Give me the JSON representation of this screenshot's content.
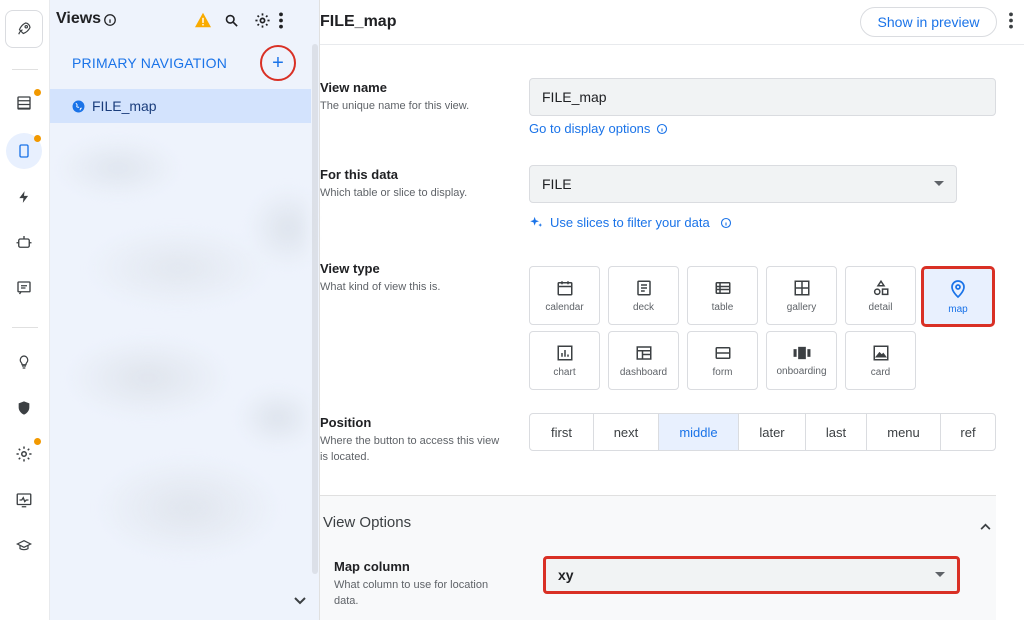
{
  "rail": {
    "icons": [
      "rocket-icon",
      "data-table-icon",
      "mobile-views-icon",
      "automation-bolt-icon",
      "bot-icon",
      "chat-icon",
      "lightbulb-icon",
      "shield-icon",
      "settings-gear-icon",
      "monitor-pulse-icon",
      "graduation-cap-icon"
    ],
    "dot_color": "#f29900"
  },
  "views_panel": {
    "title": "Views",
    "nav_section": "PRIMARY NAVIGATION",
    "add_label": "+",
    "items": [
      {
        "label": "FILE_map"
      }
    ]
  },
  "main": {
    "title": "FILE_map",
    "preview_button": "Show in preview",
    "view_name": {
      "label": "View name",
      "description": "The unique name for this view.",
      "value": "FILE_map",
      "link": "Go to display options"
    },
    "for_data": {
      "label": "For this data",
      "description": "Which table or slice to display.",
      "value": "FILE",
      "link": "Use slices to filter your data"
    },
    "view_type": {
      "label": "View type",
      "description": "What kind of view this is.",
      "options": [
        "calendar",
        "deck",
        "table",
        "gallery",
        "detail",
        "map",
        "chart",
        "dashboard",
        "form",
        "onboarding",
        "card"
      ],
      "selected": "map"
    },
    "position": {
      "label": "Position",
      "description": "Where the button to access this view is located.",
      "options": [
        "first",
        "next",
        "middle",
        "later",
        "last",
        "menu",
        "ref"
      ],
      "selected": "middle"
    },
    "view_options": {
      "title": "View Options",
      "map_column": {
        "label": "Map column",
        "description": "What column to use for location data.",
        "value": "xy"
      }
    }
  },
  "colors": {
    "accent": "#1a73e8",
    "highlight": "#d93025",
    "selected_bg": "#e8f0fe",
    "panel_bg": "#eef3fc",
    "warning": "#f9ab00"
  }
}
